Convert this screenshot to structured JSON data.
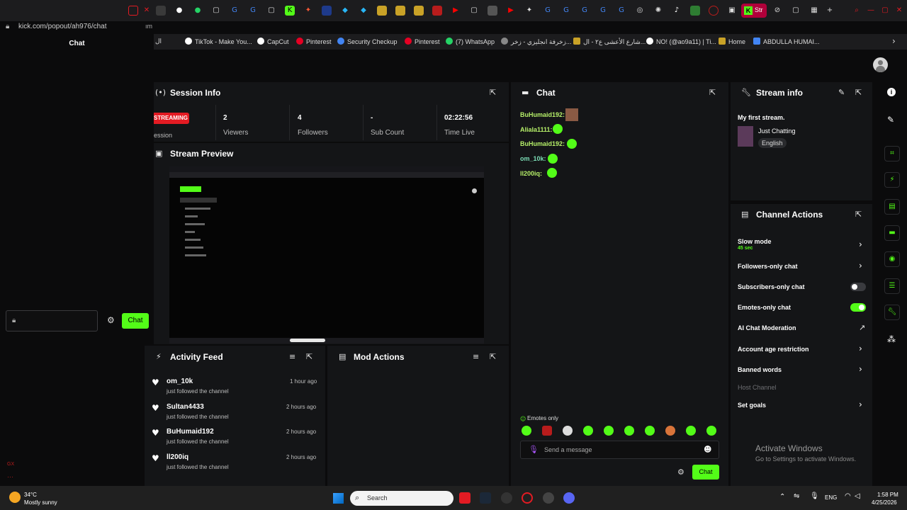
{
  "url": "kick.com/popout/ah976/chat",
  "url_tail": "ım",
  "popout_title": "Chat",
  "popout_send": "Chat",
  "bookmarks": [
    {
      "label": "ال",
      "color": "#888"
    },
    {
      "label": "TikTok - Make You...",
      "color": "#ffffff"
    },
    {
      "label": "CapCut",
      "color": "#ffffff"
    },
    {
      "label": "Pinterest",
      "color": "#e60023"
    },
    {
      "label": "Security Checkup",
      "color": "#4285f4"
    },
    {
      "label": "Pinterest",
      "color": "#e60023"
    },
    {
      "label": "(7) WhatsApp",
      "color": "#25d366"
    },
    {
      "label": "زخرفة انجليزي - زخر...",
      "color": "#888"
    },
    {
      "label": "شارع الأعشى ع٢ - ال...",
      "color": "#c9a227"
    },
    {
      "label": "NO! (@ao9a11) | Ti...",
      "color": "#ffffff"
    },
    {
      "label": "Home",
      "color": "#c9a227"
    },
    {
      "label": "ABDULLA HUMAI...",
      "color": "#4285f4"
    }
  ],
  "session": {
    "title": "Session Info",
    "badge": "STREAMING",
    "badge_sub": "ession",
    "stats": [
      {
        "value": "2",
        "label": "Viewers"
      },
      {
        "value": "4",
        "label": "Followers"
      },
      {
        "value": "-",
        "label": "Sub Count"
      },
      {
        "value": "02:22:56",
        "label": "Time Live"
      }
    ]
  },
  "preview": {
    "title": "Stream Preview"
  },
  "chat": {
    "title": "Chat",
    "messages": [
      {
        "user": "BuHumaid192:",
        "color": "#b6f069",
        "emote": "face"
      },
      {
        "user": "Aliala1111:",
        "color": "#b6f069",
        "emote": "green"
      },
      {
        "user": "BuHumaid192:",
        "color": "#b6f069",
        "emote": "green"
      },
      {
        "user": "om_10k:",
        "color": "#7bdcb5",
        "emote": "green"
      },
      {
        "user": "ll200iq:",
        "color": "#b6f069",
        "emote": "green"
      }
    ],
    "mode_note": "Emotes only",
    "placeholder": "Send a message",
    "send_label": "Chat"
  },
  "activity": {
    "title": "Activity Feed",
    "items": [
      {
        "user": "om_10k",
        "action": "just followed the channel",
        "time": "1 hour ago"
      },
      {
        "user": "Sultan4433",
        "action": "just followed the channel",
        "time": "2 hours ago"
      },
      {
        "user": "BuHumaid192",
        "action": "just followed the channel",
        "time": "2 hours ago"
      },
      {
        "user": "ll200iq",
        "action": "just followed the channel",
        "time": "2 hours ago"
      }
    ]
  },
  "mod_actions": {
    "title": "Mod Actions"
  },
  "stream_info": {
    "title": "Stream info",
    "stream_title": "My first stream.",
    "category": "Just Chatting",
    "language": "English"
  },
  "channel_actions": {
    "title": "Channel Actions",
    "slow_mode": {
      "label": "Slow mode",
      "sub": "45 sec"
    },
    "followers_only": "Followers-only chat",
    "subscribers_only": "Subscribers-only chat",
    "subscribers_only_on": false,
    "emotes_only": "Emotes-only chat",
    "emotes_only_on": true,
    "ai_moderation": "AI Chat Moderation",
    "account_age": "Account age restriction",
    "banned_words": "Banned words",
    "host_channel": "Host Channel",
    "set_goals": "Set goals"
  },
  "watermark": {
    "title": "Activate Windows",
    "sub": "Go to Settings to activate Windows."
  },
  "taskbar": {
    "weather_temp": "34°C",
    "weather_desc": "Mostly sunny",
    "search": "Search",
    "lang": "ENG",
    "time": "1:58 PM",
    "date": "4/25/2026"
  },
  "colors": {
    "accent": "#53fc18",
    "panel": "#141517",
    "badge": "#e31b23"
  }
}
